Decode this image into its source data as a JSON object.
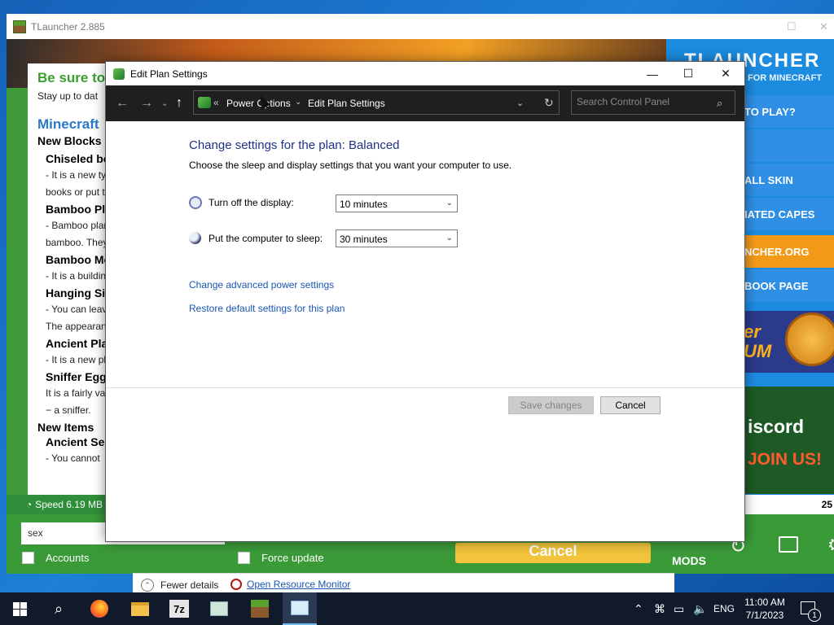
{
  "tlauncher": {
    "title": "TLauncher 2.885",
    "news": {
      "heading1": "Be sure to",
      "line1": "Stay up to dat",
      "heading2": "Minecraft",
      "new_blocks": "New Blocks",
      "chiseled": "Chiseled bo",
      "chiseled_text1": "- It is a new ty",
      "chiseled_text2": "books or put t",
      "bamboo_planks": "Bamboo Pla",
      "bamboo_text1": "- Bamboo plan",
      "bamboo_text2": "bamboo. They",
      "bamboo_mosaic": "Bamboo Mo",
      "mosaic_text": "- It is a buildin",
      "hanging_signs": "Hanging Sig",
      "hanging_text1": "- You can leav",
      "hanging_text2": "The appearan",
      "ancient_plant": "Ancient Pla",
      "ancient_text": "- It is a new pl",
      "sniffer_egg": "Sniffer Egg",
      "sniffer_text1": "It is a fairly va",
      "sniffer_text2": "− a sniffer.",
      "new_items": "New Items",
      "ancient_seeds": "Ancient See",
      "seeds_text": "- You cannot"
    },
    "brand": "TLAUNCHER",
    "brand_sub": "FOR MINECRAFT",
    "menu": {
      "play": "TO PLAY?",
      "skin": "ALL SKIN",
      "capes": "IATED CAPES",
      "site": "NCHER.ORG",
      "facebook": "BOOK PAGE"
    },
    "ad1_text": "er\nUM",
    "discord_line1": "iscord",
    "discord_line2": "JOIN US!",
    "speed": "Speed 6.19 MB",
    "counter": "25",
    "search_value": "sex",
    "accounts_label": "Accounts",
    "force_update_label": "Force update",
    "cancel_label": "Cancel",
    "mods_label": "MODS"
  },
  "taskmanager": {
    "fewer_details": "Fewer details",
    "open_resource_monitor": "Open Resource Monitor"
  },
  "dialog": {
    "title": "Edit Plan Settings",
    "breadcrumb": [
      "Power Options",
      "Edit Plan Settings"
    ],
    "search_placeholder": "Search Control Panel",
    "heading": "Change settings for the plan: Balanced",
    "description": "Choose the sleep and display settings that you want your computer to use.",
    "display_label": "Turn off the display:",
    "display_value": "10 minutes",
    "sleep_label": "Put the computer to sleep:",
    "sleep_value": "30 minutes",
    "advanced_link": "Change advanced power settings",
    "restore_link": "Restore default settings for this plan",
    "save_button": "Save changes",
    "cancel_button": "Cancel"
  },
  "taskbar": {
    "language": "ENG",
    "time": "11:00 AM",
    "date": "7/1/2023",
    "notification_count": "1",
    "apps": [
      "firefox-icon",
      "file-explorer-icon",
      "7zip-icon",
      "task-manager-icon",
      "tlauncher-icon",
      "control-panel-icon"
    ]
  }
}
